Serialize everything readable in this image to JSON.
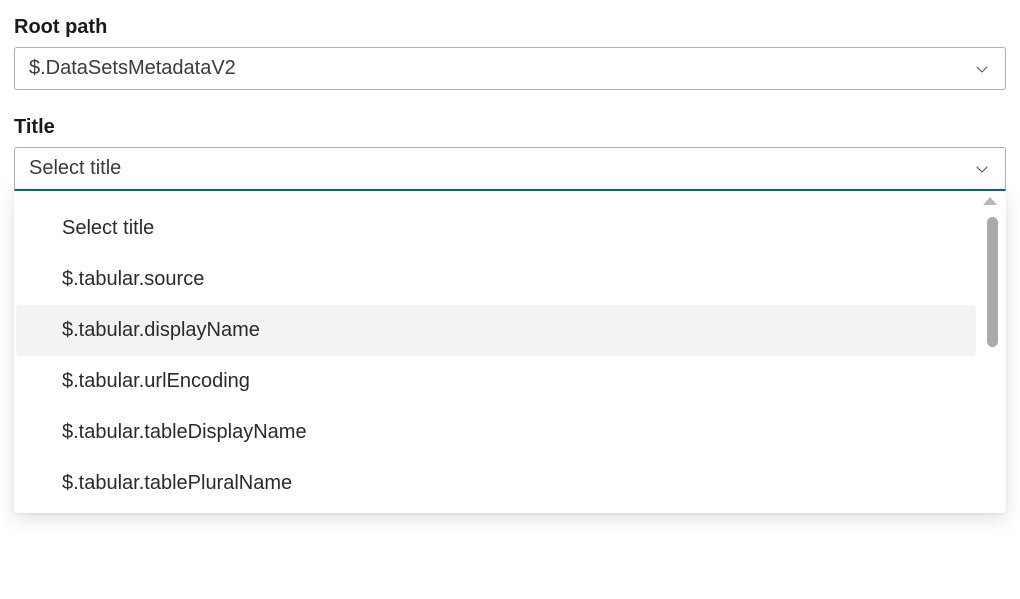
{
  "rootPath": {
    "label": "Root path",
    "value": "$.DataSetsMetadataV2"
  },
  "title": {
    "label": "Title",
    "placeholder": "Select title",
    "options": [
      "Select title",
      "$.tabular.source",
      "$.tabular.displayName",
      "$.tabular.urlEncoding",
      "$.tabular.tableDisplayName",
      "$.tabular.tablePluralName"
    ],
    "highlightedIndex": 2
  }
}
